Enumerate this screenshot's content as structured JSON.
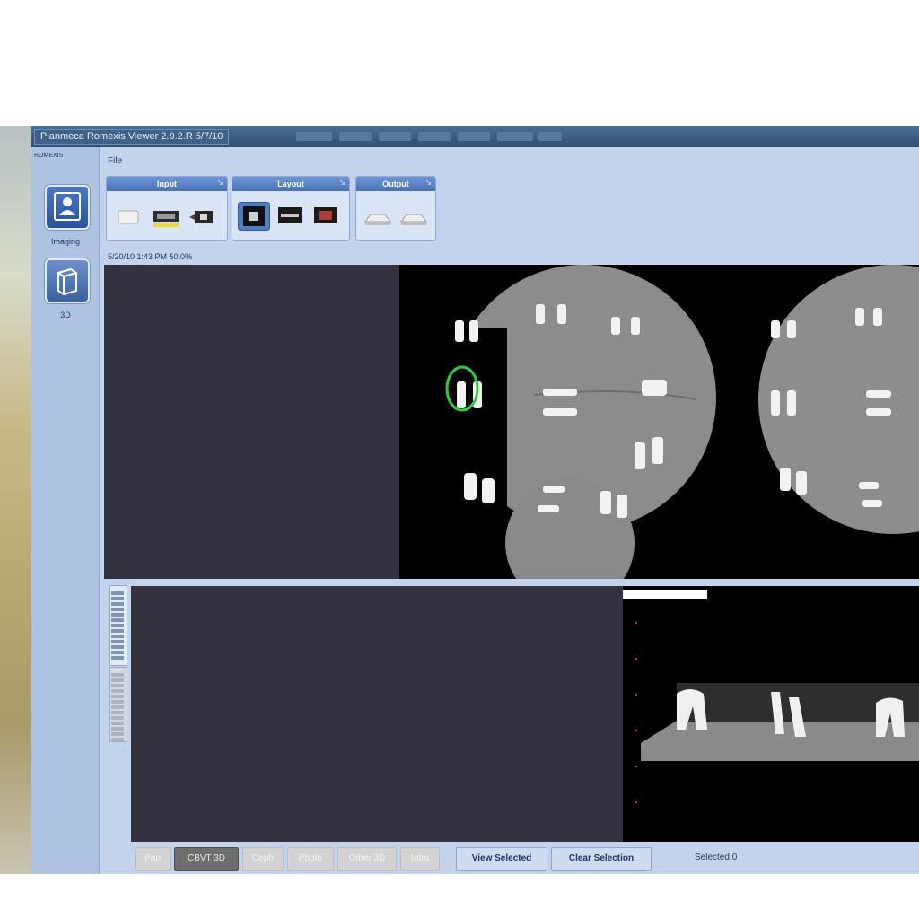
{
  "window": {
    "title": "Planmeca Romexis Viewer 2.9.2.R 5/7/10",
    "menu_file": "File"
  },
  "nav": {
    "top_text": "ROMEXIS",
    "imaging_label": "Imaging",
    "second_label": "3D"
  },
  "ribbon": {
    "groups": [
      {
        "label": "Input"
      },
      {
        "label": "Layout"
      },
      {
        "label": "Output"
      }
    ]
  },
  "status_line": "5/20/10 1:43 PM   50.0%",
  "bottom_bar": {
    "buttons": [
      "Pan",
      "CBVT 3D",
      "Ceph",
      "Photo",
      "Other 3D",
      "Intra"
    ],
    "view_selected": "View Selected",
    "clear_selection": "Clear Selection",
    "selected_text": "Selected:0"
  },
  "colors": {
    "window_bg": "#c3d3ec",
    "titlebar": "#2f4e74",
    "nav_button": "#27549c",
    "marker": "#2ecc40"
  }
}
